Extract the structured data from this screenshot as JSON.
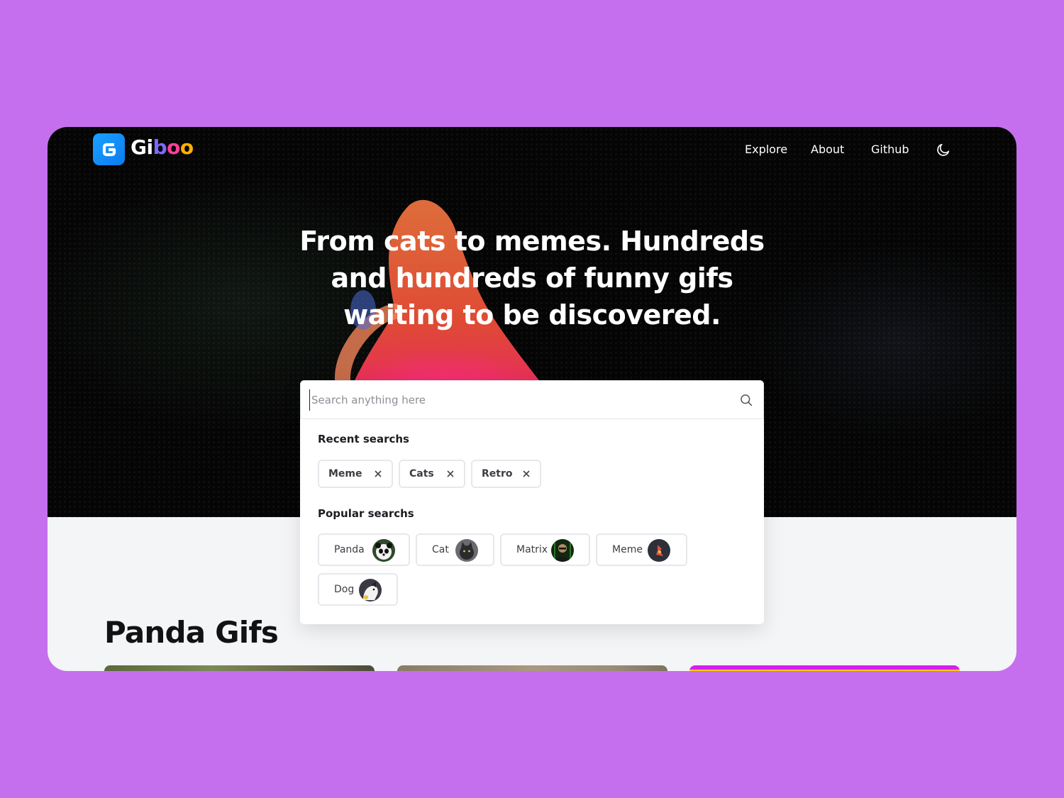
{
  "brand": {
    "name_g": "Gi",
    "name_b": "b",
    "name_o1": "o",
    "name_o2": "o",
    "mark_letter": "G"
  },
  "nav": {
    "links": [
      {
        "label": "Explore"
      },
      {
        "label": "About"
      },
      {
        "label": "Github"
      }
    ],
    "theme_toggle_icon": "moon-icon"
  },
  "hero": {
    "headline": "From cats to memes. Hundreds and hundreds of funny gifs waiting to be discovered."
  },
  "search": {
    "placeholder": "Search anything here",
    "value": "",
    "icon": "search-icon",
    "recent_title": "Recent searchs",
    "recent": [
      {
        "label": "Meme"
      },
      {
        "label": "Cats"
      },
      {
        "label": "Retro"
      }
    ],
    "popular_title": "Popular searchs",
    "popular": [
      {
        "label": "Panda"
      },
      {
        "label": "Cat"
      },
      {
        "label": "Matrix"
      },
      {
        "label": "Meme"
      },
      {
        "label": "Dog"
      }
    ]
  },
  "gallery": {
    "title": "Panda Gifs"
  },
  "colors": {
    "page_bg": "#c56fee",
    "hero_bg": "#050505",
    "brand_blue": "#0a7cf0",
    "accent_pink": "#ff3d9a",
    "accent_yellow": "#ffb000"
  }
}
